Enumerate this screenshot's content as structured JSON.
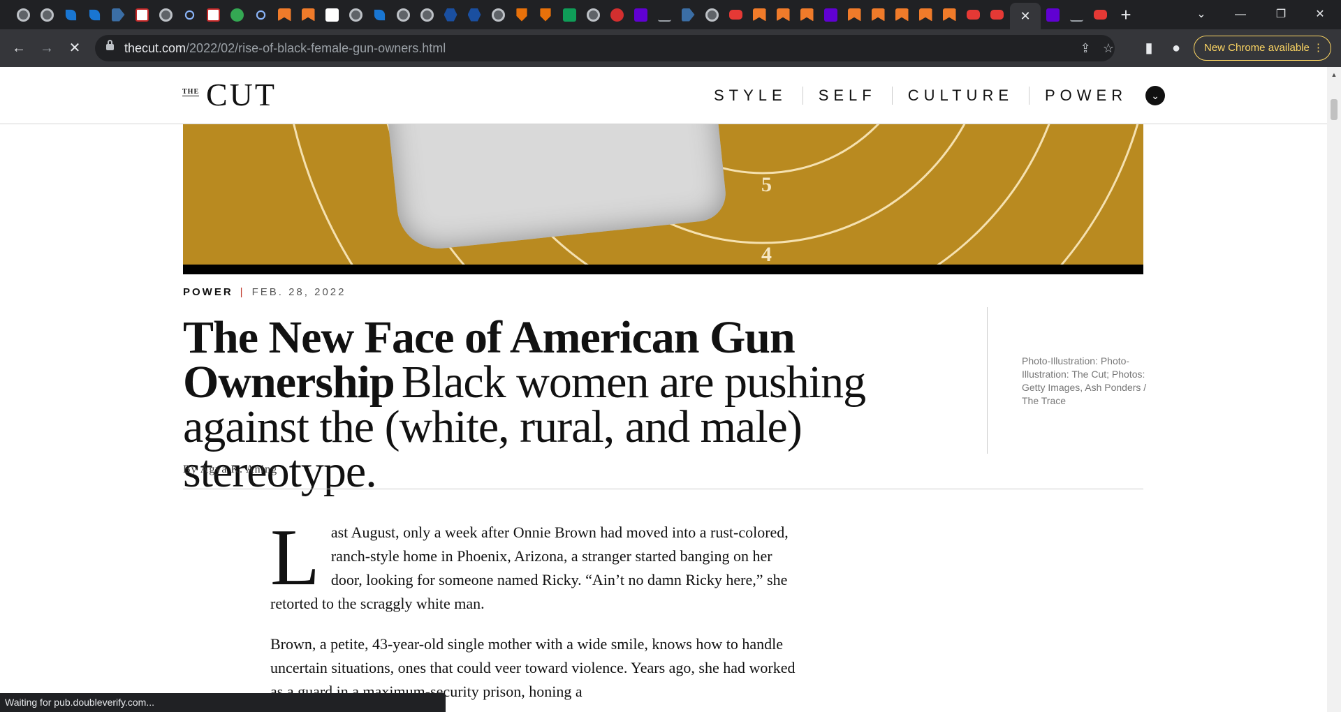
{
  "browser": {
    "tabs_left": [
      "globe",
      "globe",
      "leaf",
      "leaf",
      "arrow",
      "bi",
      "globe",
      "search",
      "bi",
      "play",
      "search",
      "bookmark",
      "bookmark",
      "t7",
      "globe",
      "leaf",
      "globe",
      "globe",
      "hex",
      "hex",
      "globe",
      "shield",
      "shield",
      "green",
      "globe",
      "mic",
      "yahoo",
      "lili",
      "arrow",
      "globe",
      "yt",
      "bookmark",
      "bookmark",
      "bookmark",
      "yahoo",
      "bookmark",
      "bookmark",
      "bookmark",
      "bookmark",
      "bookmark",
      "yt",
      "yt",
      "yahoo"
    ],
    "active_tab_icon": "✕",
    "tabs_right": [
      "yahoo",
      "lili",
      "yt"
    ],
    "new_tab_icon": "+",
    "tab_search_icon": "⌄",
    "window_controls": {
      "minimize": "—",
      "restore": "❐",
      "close": "✕"
    },
    "nav": {
      "back": "←",
      "forward": "→",
      "stop": "✕"
    },
    "url_host": "thecut.com",
    "url_path": "/2022/02/rise-of-black-female-gun-owners.html",
    "share_icon": "⇪",
    "star_icon": "☆",
    "side_panel_icon": "▮",
    "profile_icon": "●",
    "update_label": "New Chrome available",
    "menu_icon": "⋮",
    "accent_color": "#fdd663"
  },
  "site": {
    "logo_the": "THE",
    "logo_cut": "CUT",
    "nav": [
      "STYLE",
      "SELF",
      "CULTURE",
      "POWER"
    ],
    "nav_menu_icon": "⌄"
  },
  "hero": {
    "numbers": [
      "5",
      "4"
    ],
    "background_color": "#b98a20"
  },
  "article": {
    "rubric": "POWER",
    "date": "FEB. 28, 2022",
    "headline": "The New Face of American Gun Ownership",
    "dek": "Black women are pushing against the (white, rural, and male) stereotype.",
    "photo_credit": "Photo-Illustration: Photo-Illustration: The Cut; Photos: Getty Images, Ash Ponders / The Trace",
    "byline": "By Agya K. Aning",
    "dropcap": "L",
    "paragraph1": "ast August, only a week after Onnie Brown had moved into a rust-colored, ranch-style home in Phoenix, Arizona, a stranger started banging on her door, looking for someone named Ricky. “Ain’t no damn Ricky here,” she retorted to the scraggly white man.",
    "paragraph2": "Brown, a petite, 43-year-old single mother with a wide smile, knows how to handle uncertain situations, ones that could veer toward violence. Years ago, she had worked as a guard in a maximum-security prison, honing a"
  },
  "status": {
    "text": "Waiting for pub.doubleverify.com..."
  }
}
